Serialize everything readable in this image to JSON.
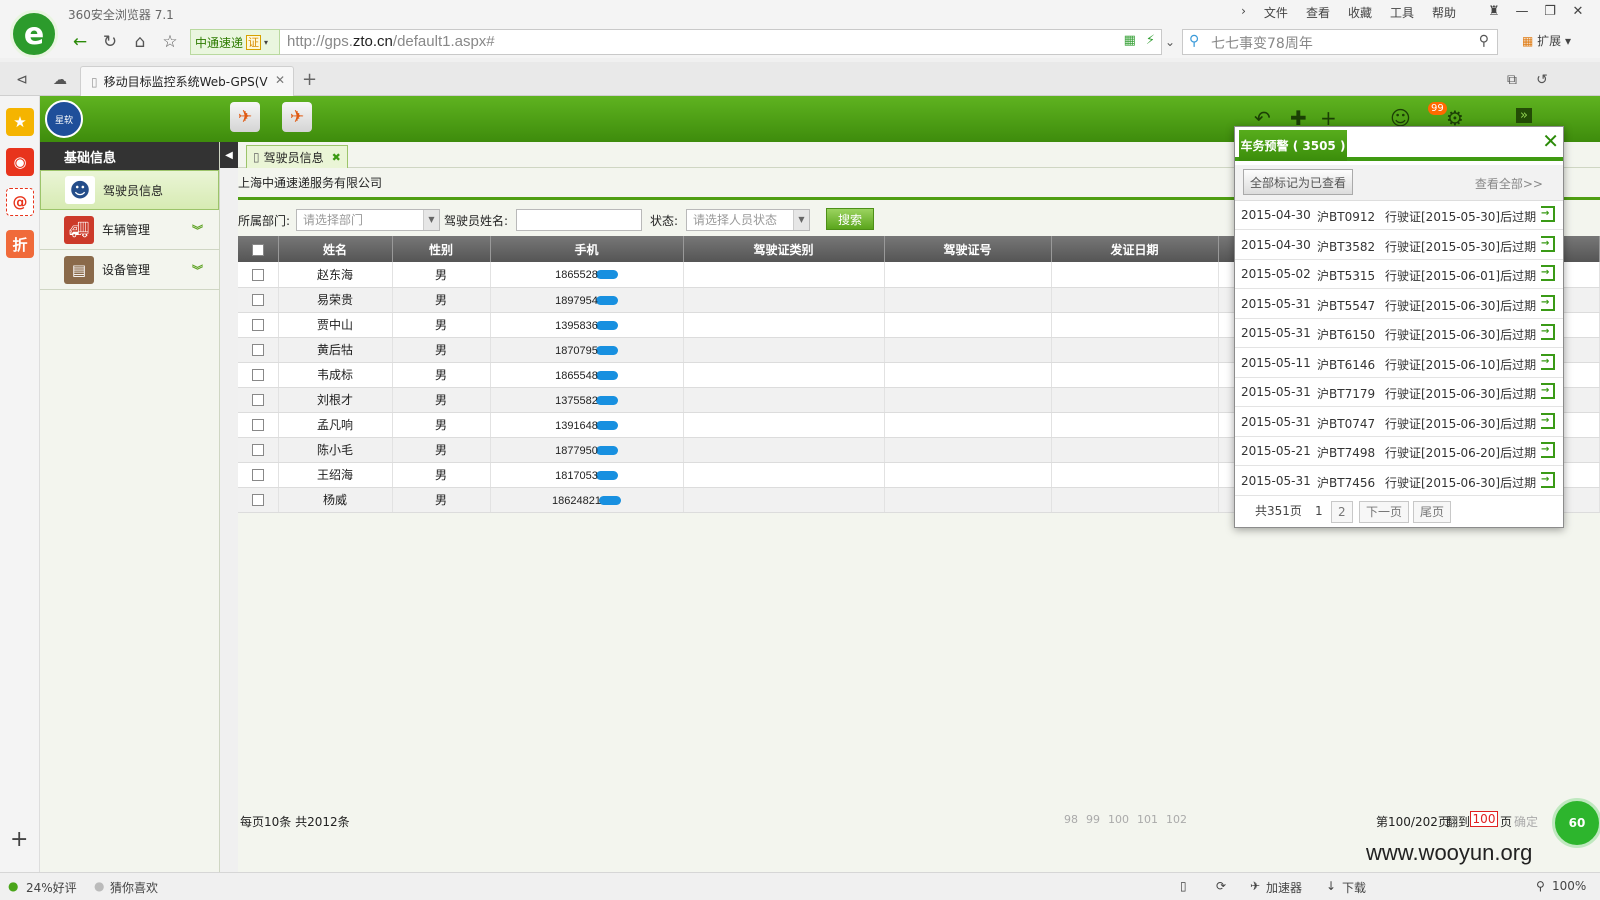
{
  "browser": {
    "name": "360安全浏览器 7.1",
    "menu": [
      "文件",
      "查看",
      "收藏",
      "工具",
      "帮助"
    ],
    "site_badge": "中通速递",
    "cert_label": "证",
    "url_prefix": "http://gps.",
    "url_domain": "zto.cn",
    "url_path": "/default1.aspx#",
    "search_placeholder": "七七事变78周年",
    "ext_label": "扩展",
    "tab_title": "移动目标监控系统Web-GPS(V",
    "sidebar_items": [
      "收藏",
      "微博",
      "邮箱",
      "折"
    ],
    "status": {
      "rating": "24%好评",
      "guess": "猜你喜欢",
      "accelerator": "加速器",
      "download": "下载",
      "zoom": "100%"
    }
  },
  "app": {
    "logo_text": "星软",
    "notification_count": "99",
    "sidebar": {
      "title": "基础信息",
      "items": [
        {
          "label": "驾驶员信息",
          "active": true
        },
        {
          "label": "车辆管理",
          "active": false
        },
        {
          "label": "设备管理",
          "active": false
        }
      ]
    },
    "main_tab": "驾驶员信息",
    "company": "上海中通速递服务有限公司",
    "filter": {
      "dept_label": "所属部门:",
      "dept_placeholder": "请选择部门",
      "name_label": "驾驶员姓名:",
      "status_label": "状态:",
      "status_placeholder": "请选择人员状态",
      "search_label": "搜索"
    },
    "grid": {
      "columns": [
        "姓名",
        "性别",
        "手机",
        "驾驶证类别",
        "驾驶证号",
        "发证日期"
      ],
      "rows": [
        {
          "name": "赵东海",
          "gender": "男",
          "phone": "1865528"
        },
        {
          "name": "易荣贵",
          "gender": "男",
          "phone": "1897954"
        },
        {
          "name": "贾中山",
          "gender": "男",
          "phone": "1395836"
        },
        {
          "name": "黄后牯",
          "gender": "男",
          "phone": "1870795"
        },
        {
          "name": "韦成标",
          "gender": "男",
          "phone": "1865548"
        },
        {
          "name": "刘根才",
          "gender": "男",
          "phone": "1375582"
        },
        {
          "name": "孟凡响",
          "gender": "男",
          "phone": "1391648"
        },
        {
          "name": "陈小毛",
          "gender": "男",
          "phone": "1877950"
        },
        {
          "name": "王绍海",
          "gender": "男",
          "phone": "1817053"
        },
        {
          "name": "杨威",
          "gender": "男",
          "phone": "18624821"
        }
      ]
    },
    "pager": {
      "summary": "每页10条  共2012条",
      "page_numbers": [
        "98",
        "99",
        "100",
        "101",
        "102"
      ],
      "current": "第100/202页",
      "goto_label": "翻到",
      "goto_value": "100",
      "page_unit": "页",
      "confirm": "确定"
    },
    "orb_text": "60"
  },
  "alert": {
    "title": "车务预警 ( 3505 )",
    "mark_read": "全部标记为已查看",
    "view_all": "查看全部>>",
    "rows": [
      {
        "date": "2015-04-30",
        "plate": "沪BT0912",
        "msg": "行驶证[2015-05-30]后过期"
      },
      {
        "date": "2015-04-30",
        "plate": "沪BT3582",
        "msg": "行驶证[2015-05-30]后过期"
      },
      {
        "date": "2015-05-02",
        "plate": "沪BT5315",
        "msg": "行驶证[2015-06-01]后过期"
      },
      {
        "date": "2015-05-31",
        "plate": "沪BT5547",
        "msg": "行驶证[2015-06-30]后过期"
      },
      {
        "date": "2015-05-31",
        "plate": "沪BT6150",
        "msg": "行驶证[2015-06-30]后过期"
      },
      {
        "date": "2015-05-11",
        "plate": "沪BT6146",
        "msg": "行驶证[2015-06-10]后过期"
      },
      {
        "date": "2015-05-31",
        "plate": "沪BT7179",
        "msg": "行驶证[2015-06-30]后过期"
      },
      {
        "date": "2015-05-31",
        "plate": "沪BT0747",
        "msg": "行驶证[2015-06-30]后过期"
      },
      {
        "date": "2015-05-21",
        "plate": "沪BT7498",
        "msg": "行驶证[2015-06-20]后过期"
      },
      {
        "date": "2015-05-31",
        "plate": "沪BT7456",
        "msg": "行驶证[2015-06-30]后过期"
      }
    ],
    "pager": {
      "total": "共351页",
      "p1": "1",
      "p2": "2",
      "next": "下一页",
      "last": "尾页"
    }
  },
  "watermark": "www.wooyun.org",
  "colors": {
    "brand_green": "#3e8c0c",
    "mask_blue": "#1890e0",
    "alert_red": "#e02020"
  }
}
